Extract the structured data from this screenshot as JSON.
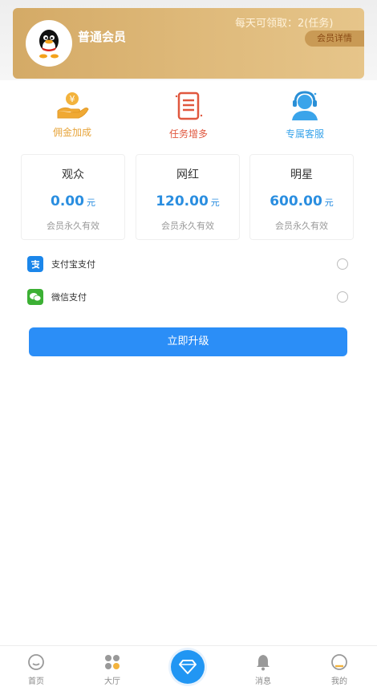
{
  "header": {
    "daily_quota": "每天可领取：2(任务)",
    "level_name": "普通会员",
    "detail_button": "会员详情"
  },
  "benefits": [
    {
      "label": "佣金加成",
      "icon": "hand-coin-icon",
      "color": "#e7a53c"
    },
    {
      "label": "任务增多",
      "icon": "document-icon",
      "color": "#e0573e"
    },
    {
      "label": "专属客服",
      "icon": "headset-service-icon",
      "color": "#3aa4ea"
    }
  ],
  "plans": [
    {
      "name": "观众",
      "price": "0.00",
      "unit": "元",
      "validity": "会员永久有效"
    },
    {
      "name": "网红",
      "price": "120.00",
      "unit": "元",
      "validity": "会员永久有效"
    },
    {
      "name": "明星",
      "price": "600.00",
      "unit": "元",
      "validity": "会员永久有效"
    }
  ],
  "payment": {
    "options": [
      {
        "label": "支付宝支付",
        "icon": "alipay-icon",
        "color": "#1b86ea",
        "selected": false
      },
      {
        "label": "微信支付",
        "icon": "wechat-icon",
        "color": "#3cb034",
        "selected": false
      }
    ]
  },
  "upgrade_button": "立即升级",
  "tabbar": {
    "items": [
      {
        "label": "首页",
        "icon": "home-icon"
      },
      {
        "label": "大厅",
        "icon": "hall-icon"
      },
      {
        "label": "",
        "icon": "diamond-icon"
      },
      {
        "label": "消息",
        "icon": "bell-icon"
      },
      {
        "label": "我的",
        "icon": "profile-icon"
      }
    ]
  },
  "colors": {
    "accent": "#2b8ef7",
    "card_gold": "#d4aa66",
    "price_blue": "#2a8ee0"
  }
}
